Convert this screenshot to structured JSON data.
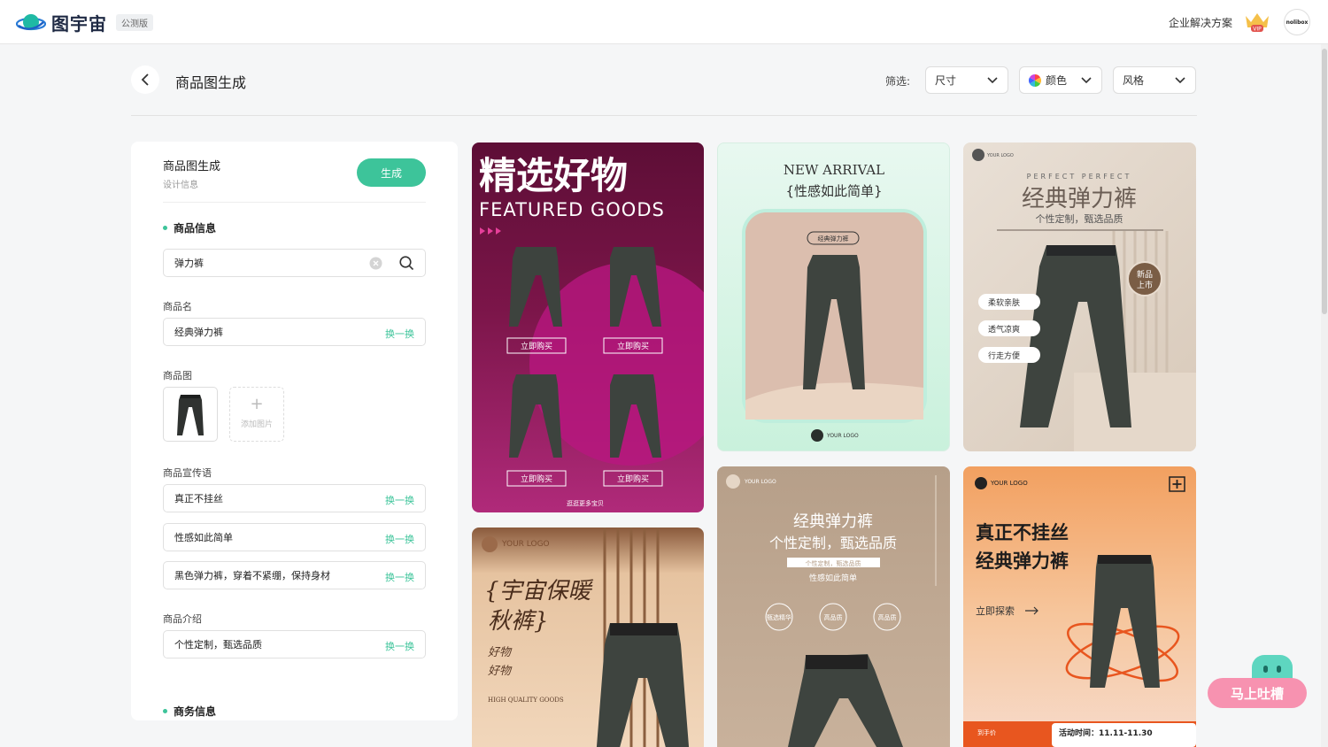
{
  "app": {
    "name": "图宇宙",
    "beta_badge": "公测版",
    "enterprise_link": "企业解决方案",
    "vip_label": "VIP",
    "user_avatar": "nolibox"
  },
  "header": {
    "title": "商品图生成",
    "filter_label": "筛选:",
    "filters": [
      {
        "label": "尺寸"
      },
      {
        "label": "颜色"
      },
      {
        "label": "风格"
      }
    ]
  },
  "panel": {
    "title": "商品图生成",
    "subtitle": "设计信息",
    "generate_label": "生成",
    "product_section": "商品信息",
    "search_value": "弹力裤",
    "name_label": "商品名",
    "name_value": "经典弹力裤",
    "swap_label": "换一换",
    "image_label": "商品图",
    "add_image_label": "添加图片",
    "slogan_label": "商品宣传语",
    "slogans": [
      "真正不挂丝",
      "性感如此简单",
      "黑色弹力裤，穿着不紧绷，保持身材"
    ],
    "intro_label": "商品介绍",
    "intro_value": "个性定制，甄选品质",
    "business_section": "商务信息"
  },
  "cards": {
    "c1": {
      "title": "精选好物",
      "subtitle": "FEATURED GOODS",
      "buy": "立即购买",
      "footer": "逛逛更多宝贝"
    },
    "c2": {
      "line1": "NEW ARRIVAL",
      "line2": "{性感如此简单}",
      "tag": "经典弹力裤",
      "logo": "YOUR LOGO"
    },
    "c3": {
      "logo": "YOUR LOGO",
      "eyebrow": "PERFECT PERFECT",
      "title": "经典弹力裤",
      "sub": "个性定制，甄选品质",
      "badge1": "新品",
      "badge2": "上市",
      "features": [
        "柔软亲肤",
        "透气凉爽",
        "行走方便"
      ]
    },
    "c4": {
      "logo": "YOUR LOGO",
      "title1": "{宇宙保暖",
      "title2": "秋裤}",
      "line1": "好物",
      "line2": "好物",
      "footer": "HIGH QUALITY GOODS"
    },
    "c5": {
      "logo": "YOUR LOGO",
      "title": "经典弹力裤",
      "sub": "个性定制，甄选品质",
      "small": "个性定制，甄选品质",
      "tiny": "性感如此简单",
      "circles": [
        "甄选精华",
        "高品质",
        "高品质"
      ]
    },
    "c6": {
      "logo": "YOUR LOGO",
      "title1": "真正不挂丝",
      "title2": "经典弹力裤",
      "explore": "立即探索",
      "price_label": "到手价",
      "activity": "活动时间：11.11-11.30"
    }
  },
  "feedback": {
    "label": "马上吐槽"
  },
  "colors": {
    "accent": "#3dc49a",
    "pink": "#f792b0"
  }
}
